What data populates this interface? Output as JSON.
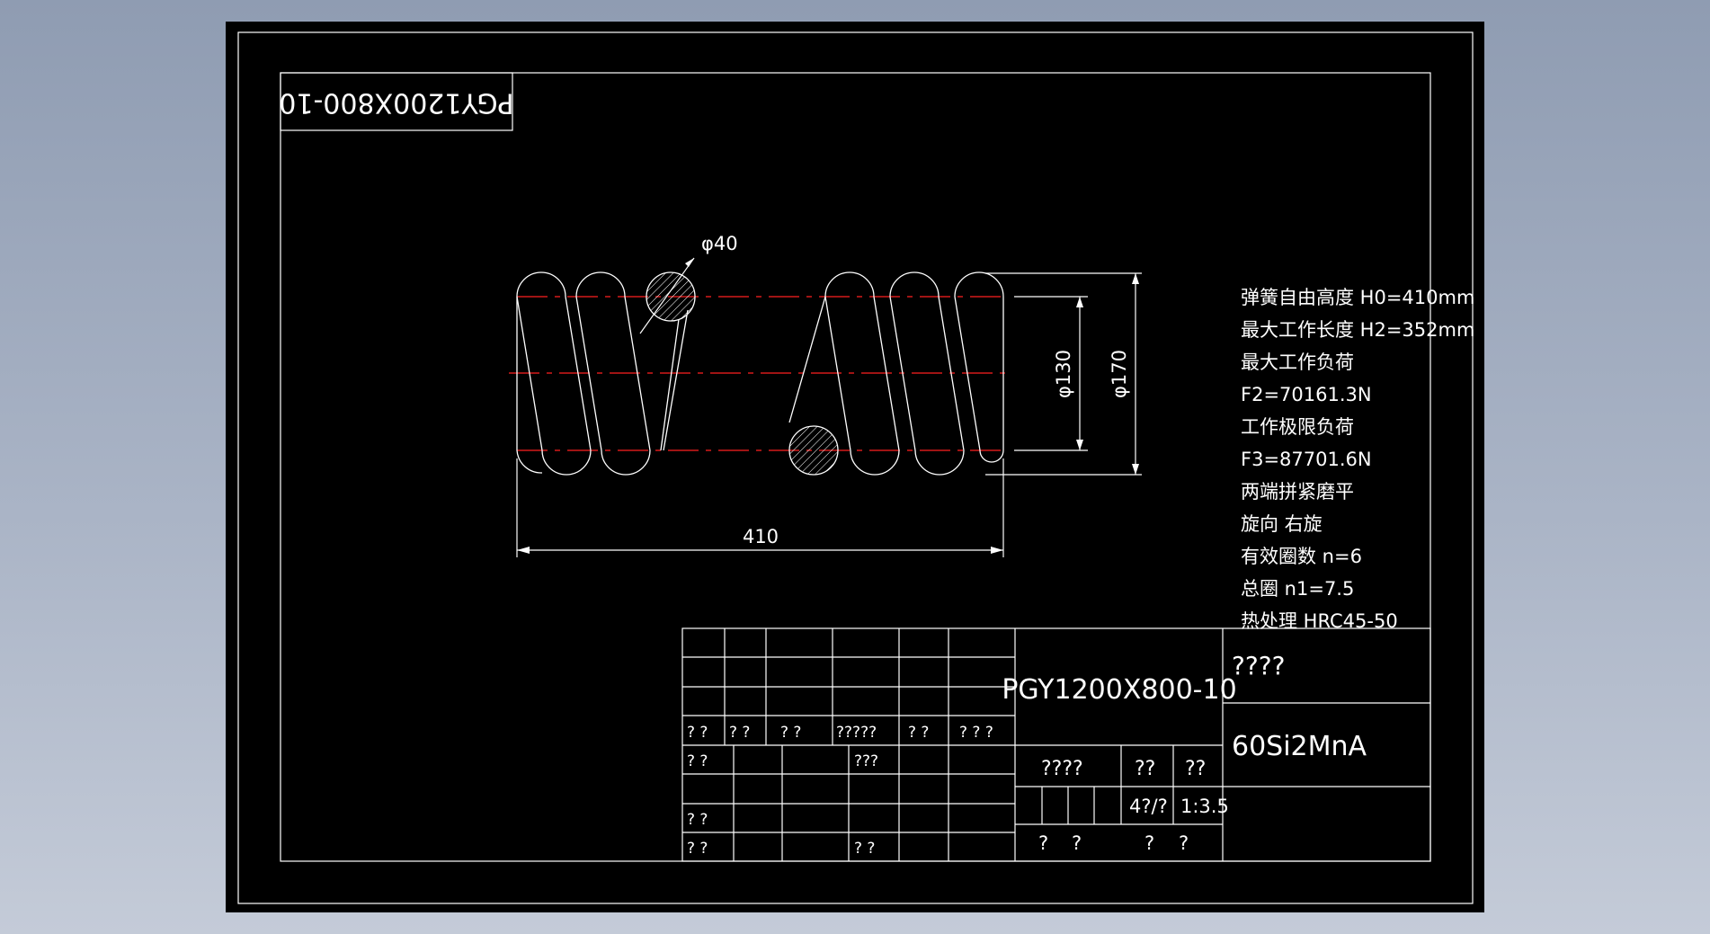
{
  "colors": {
    "background": "#000000",
    "lines": "#ffffff",
    "centerline": "#ff2020",
    "hatch": "#ffffff"
  },
  "drawing": {
    "rotated_title": "PGY1200X800-10",
    "dimensions": {
      "wire_dia": "φ40",
      "inner_dia": "φ130",
      "outer_dia": "φ170",
      "free_length": "410"
    },
    "specs": [
      "弹簧自由高度 H0=410mm",
      "最大工作长度 H2=352mm",
      "最大工作负荷",
      "F2=70161.3N",
      "工作极限负荷",
      "F3=87701.6N",
      "两端拼紧磨平",
      "旋向 右旋",
      "有效圈数 n=6",
      "总圈 n1=7.5",
      "热处理 HRC45-50"
    ]
  },
  "title_block": {
    "drawing_no": "PGY1200X800-10",
    "name": "????",
    "material": "60Si2MnA",
    "scale": "1:3.5",
    "label_stage": "????",
    "label_weight": "??",
    "label_scale": "??",
    "sheet": "4?/?",
    "footer": [
      "?",
      "?",
      "?",
      "?"
    ],
    "revision_headers": [
      "? ?",
      "? ?",
      "? ?",
      "?????",
      "? ?",
      "? ? ?"
    ],
    "sign_labels": [
      "? ?",
      "? ?",
      "? ?"
    ],
    "sign_mid": [
      "???",
      "? ?"
    ]
  }
}
